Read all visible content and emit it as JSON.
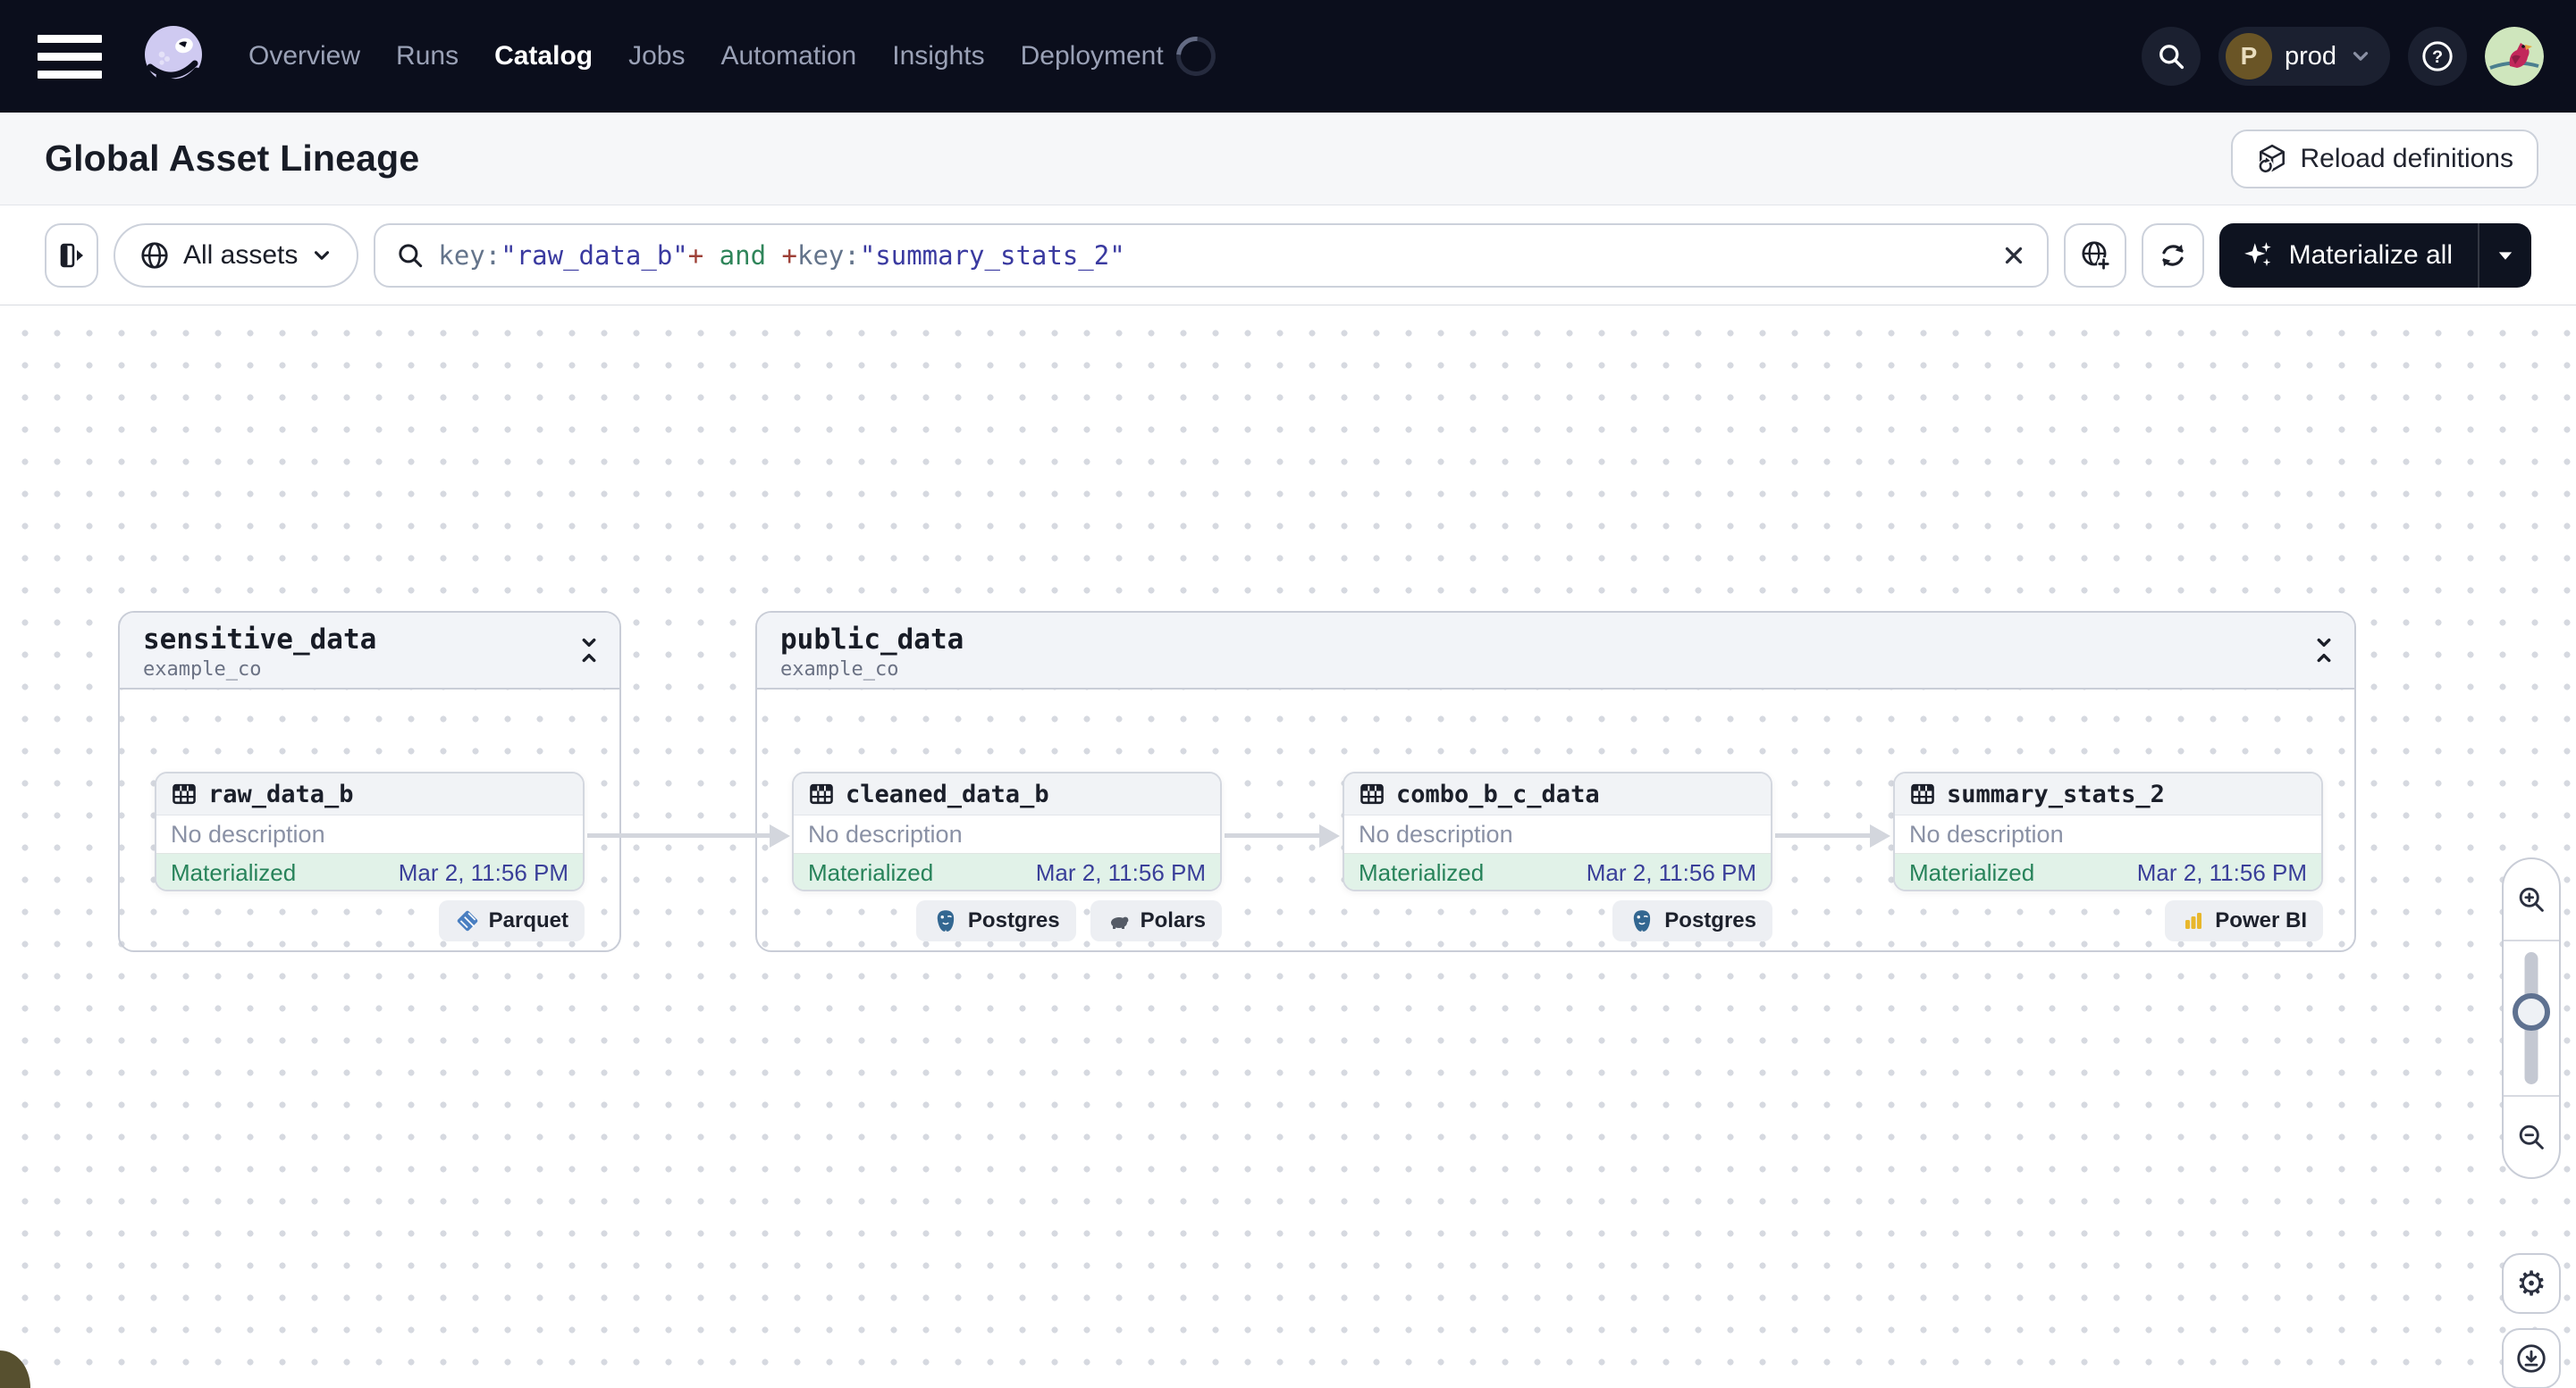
{
  "nav": {
    "items": [
      {
        "label": "Overview"
      },
      {
        "label": "Runs"
      },
      {
        "label": "Catalog"
      },
      {
        "label": "Jobs"
      },
      {
        "label": "Automation"
      },
      {
        "label": "Insights"
      },
      {
        "label": "Deployment"
      }
    ],
    "active_item": "Catalog",
    "deployment": {
      "initial": "P",
      "name": "prod"
    }
  },
  "header": {
    "title": "Global Asset Lineage",
    "reload_label": "Reload definitions"
  },
  "toolbar": {
    "scope_label": "All assets",
    "query_tokens": [
      {
        "text": "key:",
        "type": "key"
      },
      {
        "text": "\"raw_data_b\"",
        "type": "string"
      },
      {
        "text": "+",
        "type": "plus"
      },
      {
        "text": " and ",
        "type": "and"
      },
      {
        "text": "+",
        "type": "plus"
      },
      {
        "text": "key:",
        "type": "key"
      },
      {
        "text": "\"summary_stats_2\"",
        "type": "string"
      }
    ],
    "materialize_label": "Materialize all"
  },
  "graph": {
    "groups": [
      {
        "name": "sensitive_data",
        "repo": "example_co",
        "nodes": [
          {
            "name": "raw_data_b",
            "description": "No description",
            "status": "Materialized",
            "timestamp": "Mar 2, 11:56 PM",
            "badges": [
              {
                "label": "Parquet",
                "icon": "parquet-icon"
              }
            ]
          }
        ]
      },
      {
        "name": "public_data",
        "repo": "example_co",
        "nodes": [
          {
            "name": "cleaned_data_b",
            "description": "No description",
            "status": "Materialized",
            "timestamp": "Mar 2, 11:56 PM",
            "badges": [
              {
                "label": "Postgres",
                "icon": "postgres-icon"
              },
              {
                "label": "Polars",
                "icon": "polars-icon"
              }
            ]
          },
          {
            "name": "combo_b_c_data",
            "description": "No description",
            "status": "Materialized",
            "timestamp": "Mar 2, 11:56 PM",
            "badges": [
              {
                "label": "Postgres",
                "icon": "postgres-icon"
              }
            ]
          },
          {
            "name": "summary_stats_2",
            "description": "No description",
            "status": "Materialized",
            "timestamp": "Mar 2, 11:56 PM",
            "badges": [
              {
                "label": "Power BI",
                "icon": "powerbi-icon"
              }
            ]
          }
        ]
      }
    ]
  },
  "colors": {
    "nav_bg": "#0b0e1c",
    "materialize_button_bg": "#0e1320",
    "materialized_text": "#27835a",
    "materialized_bg": "#e1f2e8",
    "timestamp_text": "#3a3f99",
    "query_key": "#64748b",
    "query_string": "#3a3aa0",
    "query_plus": "#9e4037",
    "query_and": "#2f855a",
    "edge": "#d3d6dd",
    "group_border": "#c9cdd7"
  }
}
